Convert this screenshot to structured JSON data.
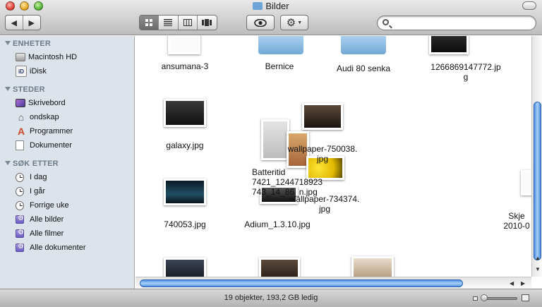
{
  "window": {
    "title": "Bilder",
    "view_modes": [
      "icon",
      "list",
      "columns",
      "cover-flow"
    ],
    "active_view": "icon"
  },
  "toolbar": {
    "back_glyph": "◀",
    "forward_glyph": "▶",
    "quicklook_icon": "eye-icon",
    "action_icon": "gear-icon",
    "search_placeholder": ""
  },
  "sidebar": {
    "devices_header": "ENHETER",
    "devices": [
      {
        "label": "Macintosh HD",
        "icon": "hard-drive-icon"
      },
      {
        "label": "iDisk",
        "icon": "idisk-icon"
      }
    ],
    "places_header": "STEDER",
    "places": [
      {
        "label": "Skrivebord",
        "icon": "desktop-icon"
      },
      {
        "label": "ondskap",
        "icon": "home-icon"
      },
      {
        "label": "Programmer",
        "icon": "applications-icon"
      },
      {
        "label": "Dokumenter",
        "icon": "documents-icon"
      }
    ],
    "search_header": "SØK ETTER",
    "searches": [
      {
        "label": "I dag",
        "icon": "clock-icon"
      },
      {
        "label": "I går",
        "icon": "clock-icon"
      },
      {
        "label": "Forrige uke",
        "icon": "clock-icon"
      },
      {
        "label": "Alle bilder",
        "icon": "smart-folder-icon"
      },
      {
        "label": "Alle filmer",
        "icon": "smart-folder-icon"
      },
      {
        "label": "Alle dokumenter",
        "icon": "smart-folder-icon"
      }
    ]
  },
  "files": [
    {
      "name": "ansumana-3",
      "kind": "document"
    },
    {
      "name": "Bernice",
      "kind": "folder"
    },
    {
      "name": "Audi 80 senka",
      "kind": "folder"
    },
    {
      "name_line1": "1266869147772.jp",
      "name_line2": "g",
      "kind": "image"
    },
    {
      "name": "galaxy.jpg",
      "kind": "image"
    },
    {
      "name": "740053.jpg",
      "kind": "image"
    },
    {
      "name": "Adium_1.3.10.jpg",
      "kind": "image"
    },
    {
      "name_line1": "Skje",
      "name_line2": "2010-0",
      "kind": "image"
    }
  ],
  "dragging": {
    "label1_line1": "wallpaper-750038.",
    "label1_line2": "jpg",
    "label2_line1": "Batteritid",
    "label2_line2": "7421_1244718923",
    "label2_line3": "743_14_86_n.jpg",
    "label3_line1": "wallpaper-734374.",
    "label3_line2": "jpg"
  },
  "status": {
    "text": "19 objekter, 193,2 GB ledig"
  },
  "colors": {
    "sidebar_bg": "#dce3ea",
    "scroll_thumb": "#5a9ae6",
    "folder": "#7fb2de"
  }
}
